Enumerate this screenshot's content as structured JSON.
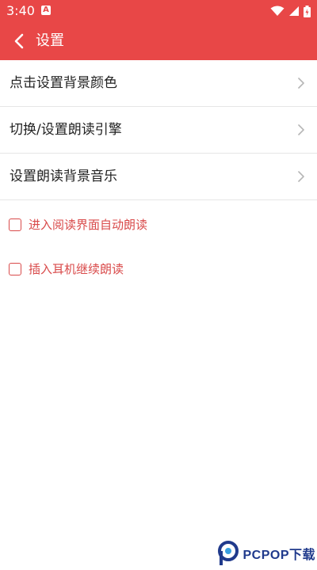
{
  "status_bar": {
    "time": "3:40",
    "app_icon_letter": "A"
  },
  "app_bar": {
    "title": "设置"
  },
  "menu": {
    "items": [
      {
        "label": "点击设置背景颜色"
      },
      {
        "label": "切换/设置朗读引擎"
      },
      {
        "label": "设置朗读背景音乐"
      }
    ]
  },
  "options": {
    "items": [
      {
        "label": "进入阅读界面自动朗读",
        "checked": false
      },
      {
        "label": "插入耳机继续朗读",
        "checked": false
      }
    ]
  },
  "watermark": {
    "text": "PCPOP下载"
  },
  "colors": {
    "primary": "#e84747",
    "option_text": "#d94a4a",
    "text": "#222222",
    "divider": "#e6e6e6"
  },
  "icons": [
    "back-arrow-icon",
    "chevron-right-icon",
    "wifi-icon",
    "signal-icon",
    "battery-icon",
    "pcpop-logo-icon"
  ]
}
